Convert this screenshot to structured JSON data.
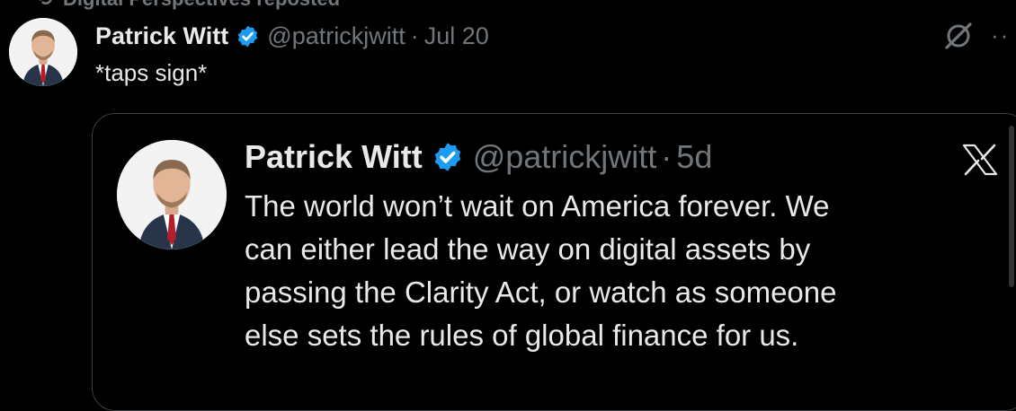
{
  "repost": {
    "text": "Digital Perspectives reposted",
    "icon": "repost-icon"
  },
  "post": {
    "author_name": "Patrick Witt",
    "handle": "@patrickjwitt",
    "separator": "·",
    "time": "Jul 20",
    "text": "*taps sign*",
    "icons": [
      "verified-badge-icon",
      "grok-icon",
      "more-icon"
    ],
    "more_label": "··"
  },
  "quoted_post": {
    "author_name": "Patrick Witt",
    "handle": "@patrickjwitt",
    "separator": "·",
    "time": "5d",
    "lines": [
      "The world won’t wait on America forever. We",
      "can either lead the way on digital assets by",
      "passing the Clarity Act, or watch as someone",
      "else sets the rules of global finance for us."
    ],
    "platform_icon": "x-logo-icon"
  },
  "colors": {
    "background": "#000000",
    "text": "#e7e9ea",
    "muted": "#71767b",
    "verified": "#1d9bf0",
    "border": "#3a3d41"
  }
}
